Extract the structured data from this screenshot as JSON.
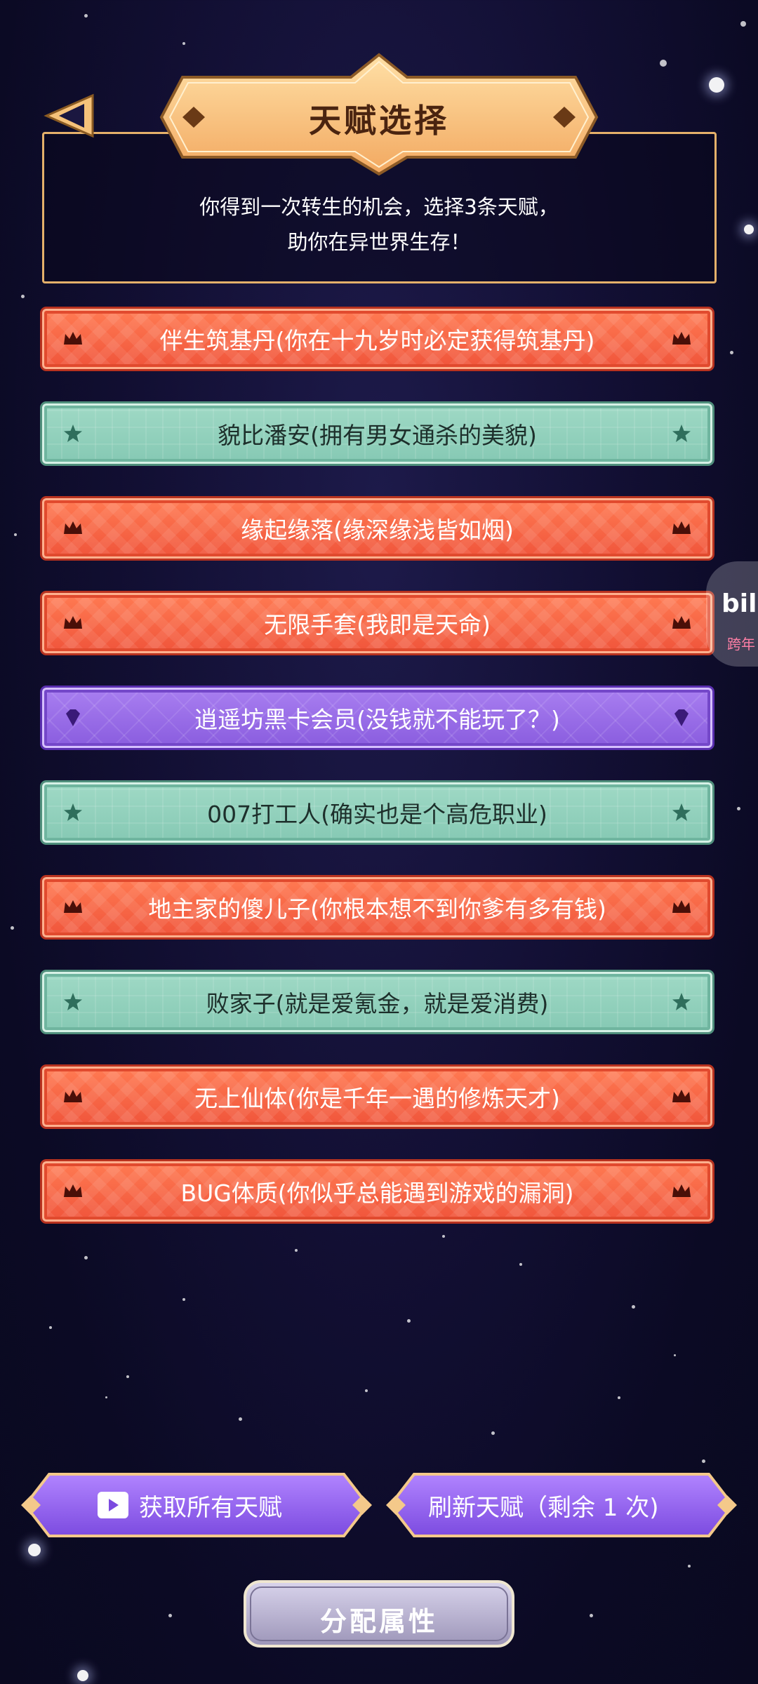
{
  "header": {
    "title": "天赋选择",
    "intro_line1": "你得到一次转生的机会，选择3条天赋，",
    "intro_line2": "助你在异世界生存！"
  },
  "talents": [
    {
      "label": "伴生筑基丹(你在十九岁时必定获得筑基丹)",
      "rarity": "orange",
      "icon": "crown-icon"
    },
    {
      "label": "貌比潘安(拥有男女通杀的美貌)",
      "rarity": "teal",
      "icon": "star-icon"
    },
    {
      "label": "缘起缘落(缘深缘浅皆如烟)",
      "rarity": "orange",
      "icon": "crown-icon"
    },
    {
      "label": "无限手套(我即是天命)",
      "rarity": "orange",
      "icon": "crown-icon"
    },
    {
      "label": "逍遥坊黑卡会员(没钱就不能玩了？)",
      "rarity": "purple",
      "icon": "diamond-icon"
    },
    {
      "label": "007打工人(确实也是个高危职业)",
      "rarity": "teal",
      "icon": "star-icon"
    },
    {
      "label": "地主家的傻儿子(你根本想不到你爹有多有钱)",
      "rarity": "orange",
      "icon": "crown-icon"
    },
    {
      "label": "败家子(就是爱氪金，就是爱消费)",
      "rarity": "teal",
      "icon": "star-icon"
    },
    {
      "label": "无上仙体(你是千年一遇的修炼天才)",
      "rarity": "orange",
      "icon": "crown-icon"
    },
    {
      "label": "BUG体质(你似乎总能遇到游戏的漏洞)",
      "rarity": "orange",
      "icon": "crown-icon"
    }
  ],
  "buttons": {
    "get_all": "获取所有天赋",
    "refresh": "刷新天赋（剩余 1 次)",
    "allocate": "分配属性"
  },
  "side_badge": {
    "text": "bili",
    "sub": "跨年"
  },
  "colors": {
    "orange": "#f0553b",
    "teal": "#86c9b4",
    "purple": "#8a5ddf",
    "title_gold": "#f6b86a"
  }
}
